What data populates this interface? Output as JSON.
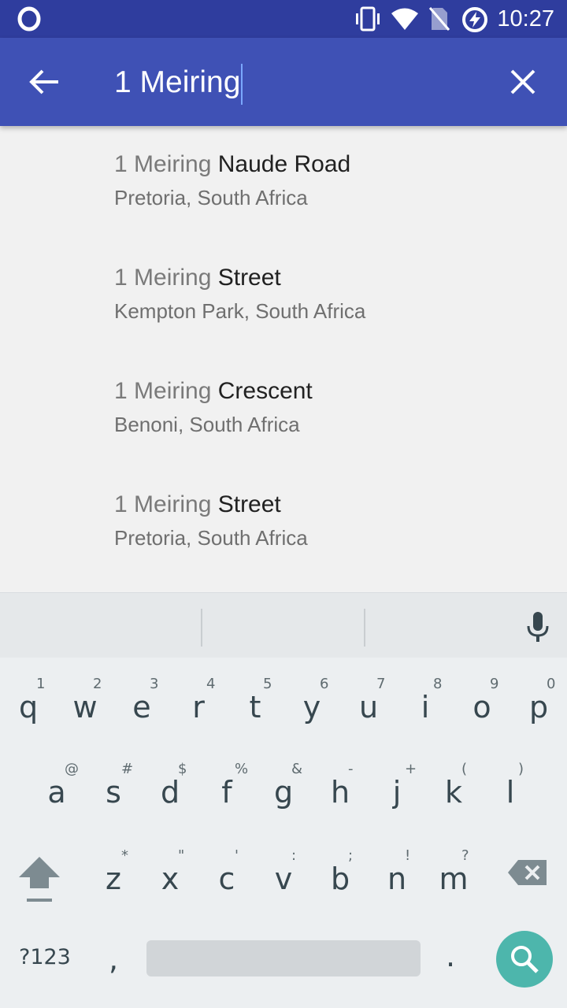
{
  "status_bar": {
    "time": "10:27",
    "icons": [
      "opera-icon",
      "vibrate-icon",
      "wifi-icon",
      "no-sim-icon",
      "battery-charging-icon"
    ]
  },
  "search_bar": {
    "query": "1 Meiring",
    "back_icon": "arrow-back-icon",
    "clear_icon": "close-icon"
  },
  "results": [
    {
      "match": "1 Meiring",
      "rest": " Naude Road",
      "secondary": "Pretoria, South Africa"
    },
    {
      "match": "1 Meiring",
      "rest": " Street",
      "secondary": "Kempton Park, South Africa"
    },
    {
      "match": "1 Meiring",
      "rest": " Crescent",
      "secondary": "Benoni, South Africa"
    },
    {
      "match": "1 Meiring",
      "rest": " Street",
      "secondary": "Pretoria, South Africa"
    }
  ],
  "keyboard": {
    "row1": [
      {
        "ch": "q",
        "hint": "1"
      },
      {
        "ch": "w",
        "hint": "2"
      },
      {
        "ch": "e",
        "hint": "3"
      },
      {
        "ch": "r",
        "hint": "4"
      },
      {
        "ch": "t",
        "hint": "5"
      },
      {
        "ch": "y",
        "hint": "6"
      },
      {
        "ch": "u",
        "hint": "7"
      },
      {
        "ch": "i",
        "hint": "8"
      },
      {
        "ch": "o",
        "hint": "9"
      },
      {
        "ch": "p",
        "hint": "0"
      }
    ],
    "row2": [
      {
        "ch": "a",
        "hint": "@"
      },
      {
        "ch": "s",
        "hint": "#"
      },
      {
        "ch": "d",
        "hint": "$"
      },
      {
        "ch": "f",
        "hint": "%"
      },
      {
        "ch": "g",
        "hint": "&"
      },
      {
        "ch": "h",
        "hint": "-"
      },
      {
        "ch": "j",
        "hint": "+"
      },
      {
        "ch": "k",
        "hint": "("
      },
      {
        "ch": "l",
        "hint": ")"
      }
    ],
    "row3": [
      {
        "ch": "z",
        "hint": "*"
      },
      {
        "ch": "x",
        "hint": "\""
      },
      {
        "ch": "c",
        "hint": "'"
      },
      {
        "ch": "v",
        "hint": ":"
      },
      {
        "ch": "b",
        "hint": ";"
      },
      {
        "ch": "n",
        "hint": "!"
      },
      {
        "ch": "m",
        "hint": "?"
      }
    ],
    "symbols_label": "?123",
    "comma": ",",
    "period": ".",
    "accent_color": "#4db6ac"
  }
}
